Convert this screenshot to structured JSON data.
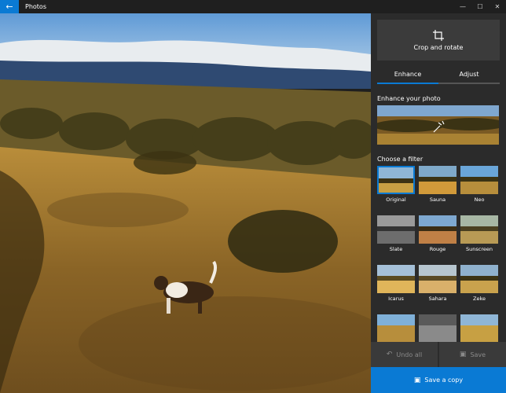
{
  "app": {
    "title": "Photos",
    "back_icon": "back-arrow-icon"
  },
  "window": {
    "minimize": "—",
    "maximize": "☐",
    "close": "✕"
  },
  "panel": {
    "crop_label": "Crop and rotate",
    "tabs": [
      {
        "label": "Enhance",
        "active": true
      },
      {
        "label": "Adjust",
        "active": false
      }
    ],
    "enhance_title": "Enhance your photo",
    "filter_title": "Choose a filter",
    "filters": [
      {
        "name": "Original",
        "selected": true,
        "sky": "#8fb6d6",
        "ground": "#c7a043"
      },
      {
        "name": "Sauna",
        "selected": false,
        "sky": "#7fa9c9",
        "ground": "#d19a3a"
      },
      {
        "name": "Neo",
        "selected": false,
        "sky": "#6aa6d9",
        "ground": "#b78e3c"
      },
      {
        "name": "Slate",
        "selected": false,
        "sky": "#9a9a9a",
        "ground": "#6d6d6d"
      },
      {
        "name": "Rouge",
        "selected": false,
        "sky": "#7ea8d0",
        "ground": "#c08046"
      },
      {
        "name": "Sunscreen",
        "selected": false,
        "sky": "#a7b7a4",
        "ground": "#b89a55"
      },
      {
        "name": "Icarus",
        "selected": false,
        "sky": "#a5c0d8",
        "ground": "#e0b55a"
      },
      {
        "name": "Sahara",
        "selected": false,
        "sky": "#b7c6cf",
        "ground": "#d9b06a"
      },
      {
        "name": "Zeke",
        "selected": false,
        "sky": "#8fb1cd",
        "ground": "#c9a24d"
      },
      {
        "name": "",
        "selected": false,
        "sky": "#7fb0d8",
        "ground": "#b78e3c"
      },
      {
        "name": "",
        "selected": false,
        "sky": "#5a5a5a",
        "ground": "#8a8a8a"
      },
      {
        "name": "",
        "selected": false,
        "sky": "#8fb6d6",
        "ground": "#c7a043"
      }
    ],
    "undo_label": "Undo all",
    "save_label": "Save",
    "save_copy_label": "Save a copy"
  },
  "colors": {
    "accent": "#0a7ad4",
    "panel": "#2b2b2b"
  }
}
